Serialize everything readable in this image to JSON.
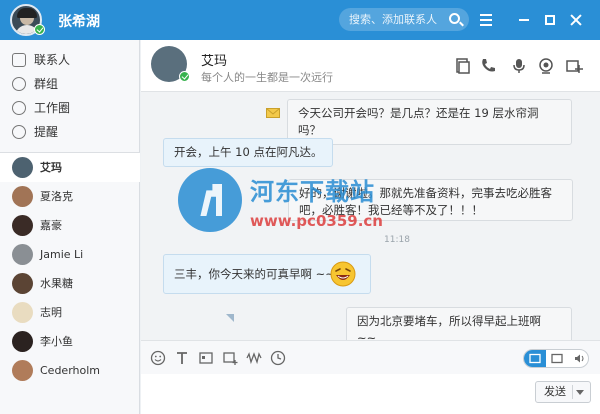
{
  "me": {
    "name": "张希湖"
  },
  "search": {
    "placeholder": "搜索、添加联系人"
  },
  "nav": [
    {
      "label": "联系人",
      "icon": "contacts-icon"
    },
    {
      "label": "群组",
      "icon": "group-icon"
    },
    {
      "label": "工作圈",
      "icon": "circle-icon"
    },
    {
      "label": "提醒",
      "icon": "check-icon"
    }
  ],
  "contacts": [
    {
      "name": "艾玛",
      "active": true
    },
    {
      "name": "夏洛克"
    },
    {
      "name": "嘉豪"
    },
    {
      "name": "Jamie Li"
    },
    {
      "name": "水果糖"
    },
    {
      "name": "志明"
    },
    {
      "name": "李小鱼"
    },
    {
      "name": "Cederholm"
    }
  ],
  "chat": {
    "peer_name": "艾玛",
    "peer_status": "每个人的一生都是一次远行",
    "messages": [
      {
        "side": "right",
        "text": "今天公司开会吗？是几点？还是在 19 层水帘洞吗？"
      },
      {
        "side": "left",
        "text": "开会，上午 10 点在阿凡达。"
      },
      {
        "side": "right",
        "text": "好的，谢谢啦。那就先准备资料，完事去吃必胜客吧，必胜客！我已经等不及了！！！"
      },
      {
        "side": "time",
        "text": "11:18"
      },
      {
        "side": "left",
        "text": "三丰，你今天来的可真早啊 ~~"
      },
      {
        "side": "right",
        "text": "因为北京要堵车，所以得早起上班啊 ~~"
      }
    ]
  },
  "composer": {
    "send_label": "发送"
  },
  "watermark": {
    "title": "河东下载站",
    "url": "www.pc0359.cn"
  },
  "colors": {
    "accent": "#2a8fd6",
    "online": "#37b24d"
  }
}
